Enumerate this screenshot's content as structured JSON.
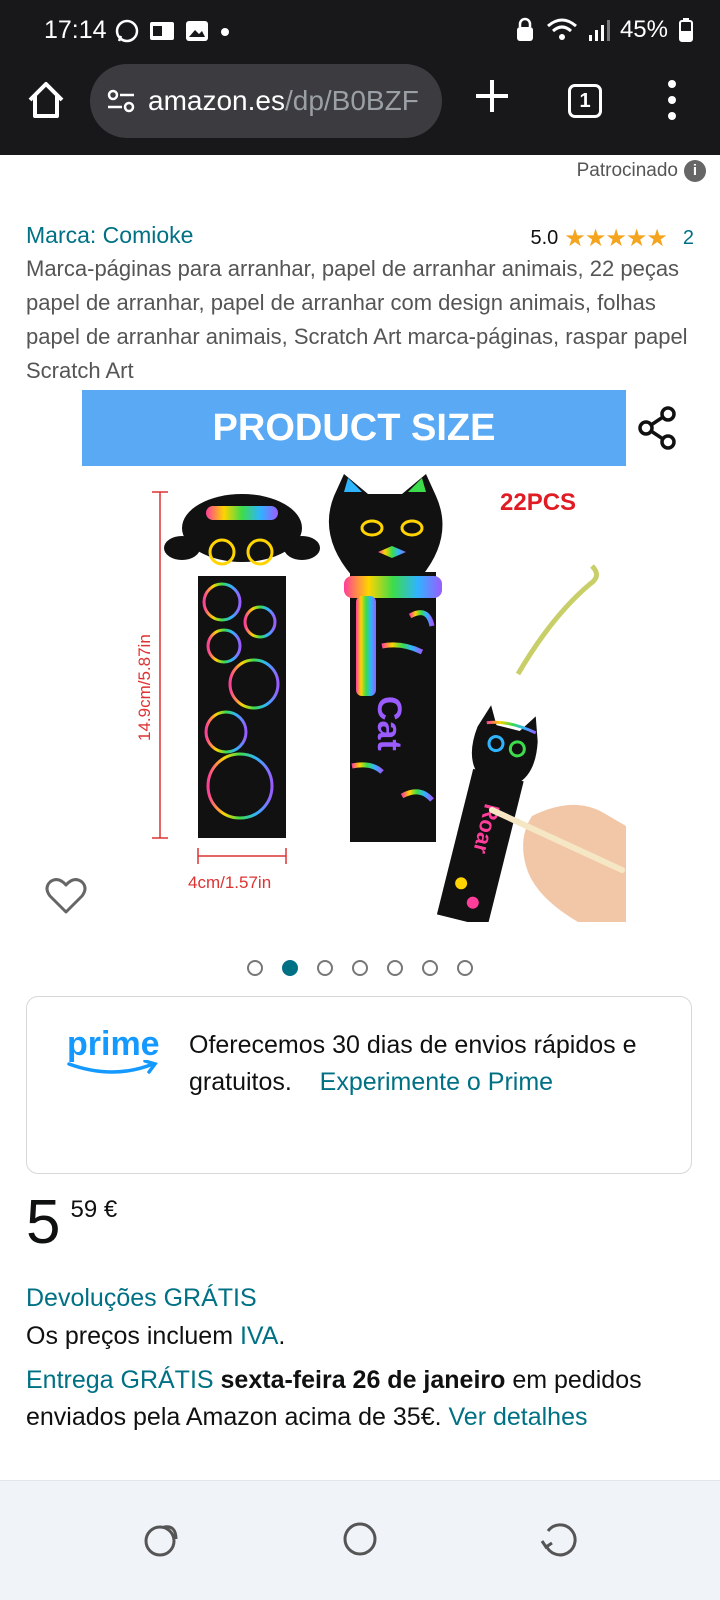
{
  "status": {
    "time": "17:14",
    "battery": "45%",
    "icons": [
      "whatsapp-icon",
      "outlook-icon",
      "gallery-icon",
      "dot-icon",
      "vpn-lock-icon",
      "wifi-icon",
      "signal-icon",
      "battery-icon"
    ]
  },
  "browser": {
    "url_domain": "amazon.es",
    "url_path": "/dp/B0BZF",
    "tab_count": "1"
  },
  "page": {
    "sponsored_label": "Patrocinado",
    "info_glyph": "i",
    "brand": "Marca: Comioke",
    "rating_value": "5.0",
    "rating_stars": "★★★★★",
    "rating_score": 5,
    "rating_count": "2",
    "title": "Marca-páginas para arranhar, papel de arranhar animais, 22 peças papel de arranhar, papel de arranhar com design animais, folhas papel de arranhar animais, Scratch Art marca-páginas, raspar papel Scratch Art",
    "image_banner": "PRODUCT SIZE",
    "image_pcs": "22PCS",
    "image_height": "14.9cm/5.87in",
    "image_width": "4cm/1.57in",
    "image_word_cat": "Cat",
    "image_word_roar": "Roar",
    "carousel": {
      "total": 7,
      "active": 2
    }
  },
  "prime": {
    "logo": "prime",
    "text": "Oferecemos 30 dias de envios rápidos e gratuitos.",
    "link": "Experimente o Prime"
  },
  "price": {
    "whole": "5",
    "fraction": "59 €"
  },
  "returns": "Devoluções GRÁTIS",
  "iva": {
    "text": "Os preços incluem ",
    "link": "IVA",
    "end": "."
  },
  "delivery": {
    "link": "Entrega GRÁTIS",
    "date": "sexta-feira 26 de janeiro",
    "text": " em pedidos enviados pela Amazon acima de 35€. ",
    "details_link": "Ver detalhes"
  },
  "colors": {
    "link": "#007185",
    "banner": "#5aa9f5",
    "stars": "#f4a41d",
    "prime": "#1399ff",
    "chrome": "#18181b"
  }
}
